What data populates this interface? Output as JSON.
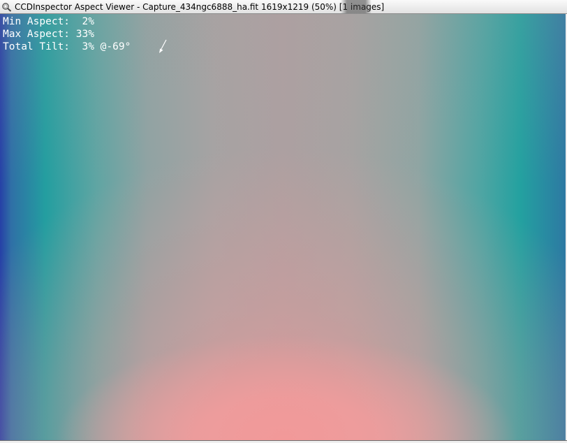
{
  "window": {
    "title": "CCDInspector Aspect Viewer - Capture_434ngc6888_ha.fit 1619x1219 (50%)  [1 images]",
    "app_icon": "ccdinspector-app-icon"
  },
  "overlay": {
    "min_aspect": "Min Aspect:  2%",
    "max_aspect": "Max Aspect: 33%",
    "total_tilt": "Total Tilt:  3% @-69°",
    "tilt_arrow_icon": "tilt-direction-arrow-icon"
  },
  "colors": {
    "edge_blue": "#2640a6",
    "teal": "#239ea0",
    "gray": "#a6a3a3",
    "pink": "#ffa3a3",
    "text": "#ffffff"
  }
}
